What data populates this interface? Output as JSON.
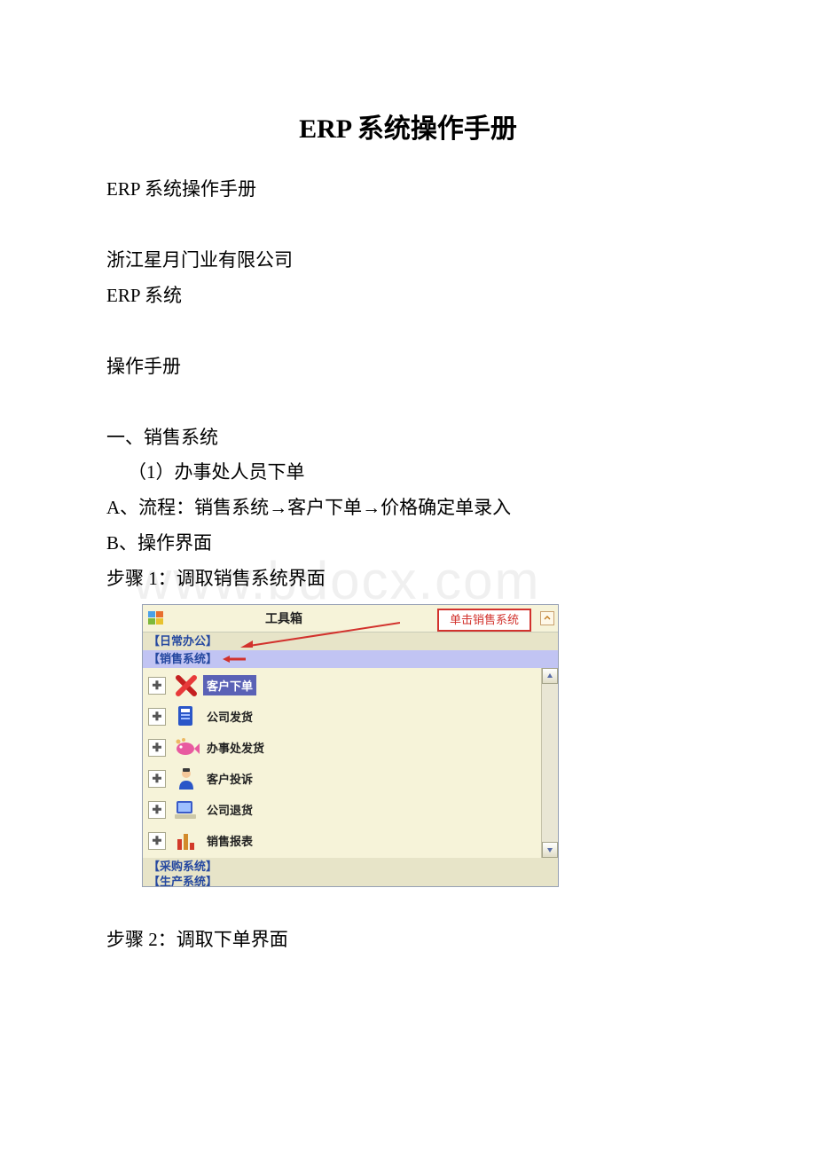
{
  "doc": {
    "title": "ERP 系统操作手册",
    "lines": {
      "l1": "ERP 系统操作手册",
      "l2": "浙江星月门业有限公司",
      "l3": "ERP 系统",
      "l4": "操作手册",
      "l5": "一、销售系统",
      "l6": "（1）办事处人员下单",
      "l7": "A、流程：销售系统→客户下单→价格确定单录入",
      "l8": "B、操作界面",
      "l9": " 步骤 1：调取销售系统界面",
      "l10": " 步骤 2：调取下单界面"
    },
    "watermark": "www.bdocx.com"
  },
  "toolbox": {
    "title": "工具箱",
    "annotation": "单击销售系统",
    "sections": {
      "daily": "【日常办公】",
      "sales": "【销售系统】",
      "purchase": "【采购系统】",
      "production": "【生产系统】"
    },
    "items": [
      {
        "label": "客户下单",
        "icon": "x-red",
        "selected": true
      },
      {
        "label": "公司发货",
        "icon": "book-blue",
        "selected": false
      },
      {
        "label": "办事处发货",
        "icon": "fish",
        "selected": false
      },
      {
        "label": "客户投诉",
        "icon": "person",
        "selected": false
      },
      {
        "label": "公司退货",
        "icon": "computer",
        "selected": false
      },
      {
        "label": "销售报表",
        "icon": "bar-chart",
        "selected": false
      }
    ],
    "expand_glyph": "✚"
  }
}
